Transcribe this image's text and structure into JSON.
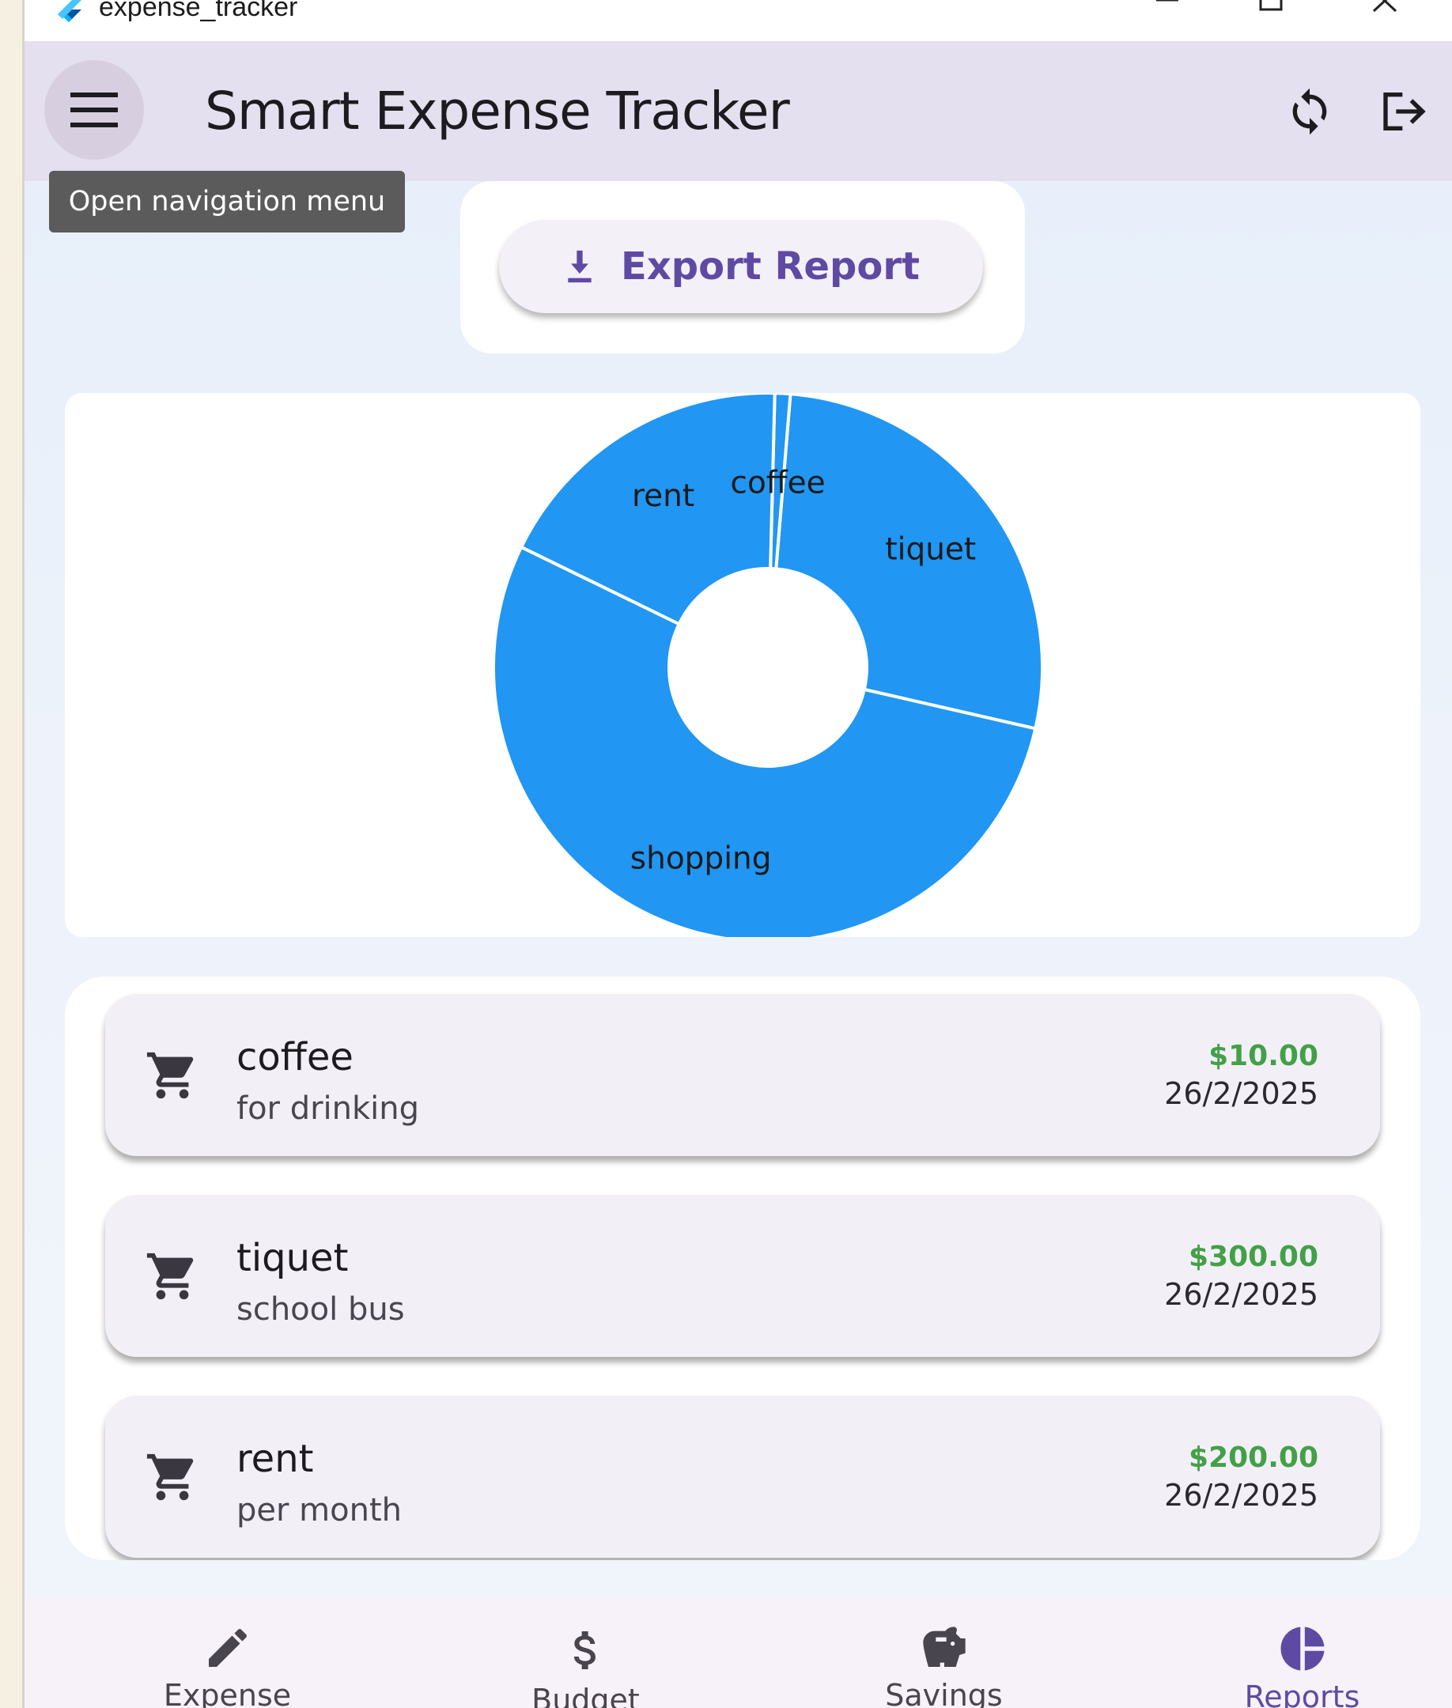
{
  "window": {
    "title": "expense_tracker"
  },
  "appbar": {
    "title": "Smart Expense Tracker",
    "tooltip": "Open navigation menu"
  },
  "export": {
    "label": "Export Report"
  },
  "colors": {
    "accent": "#5f4aa3",
    "pie": "#2196f3",
    "amount": "#43a047",
    "appbar": "#e4e0ef"
  },
  "chart_data": {
    "type": "pie",
    "donut": true,
    "categories": [
      "tiquet",
      "coffee",
      "rent",
      "shopping"
    ],
    "values": [
      300,
      10,
      200,
      590
    ],
    "colors": [
      "#2196f3",
      "#2196f3",
      "#2196f3",
      "#2196f3"
    ]
  },
  "expenses": [
    {
      "title": "coffee",
      "description": "for drinking",
      "amount": "$10.00",
      "date": "26/2/2025",
      "icon": "shopping-cart-icon"
    },
    {
      "title": "tiquet",
      "description": "school bus",
      "amount": "$300.00",
      "date": "26/2/2025",
      "icon": "shopping-cart-icon"
    },
    {
      "title": "rent",
      "description": "per month",
      "amount": "$200.00",
      "date": "26/2/2025",
      "icon": "shopping-cart-icon"
    }
  ],
  "nav": [
    {
      "label": "Expense",
      "icon": "pencil-icon",
      "active": false
    },
    {
      "label": "Budget",
      "icon": "dollar-icon",
      "active": false
    },
    {
      "label": "Savings",
      "icon": "piggy-bank-icon",
      "active": false
    },
    {
      "label": "Reports",
      "icon": "pie-chart-icon",
      "active": true
    }
  ]
}
